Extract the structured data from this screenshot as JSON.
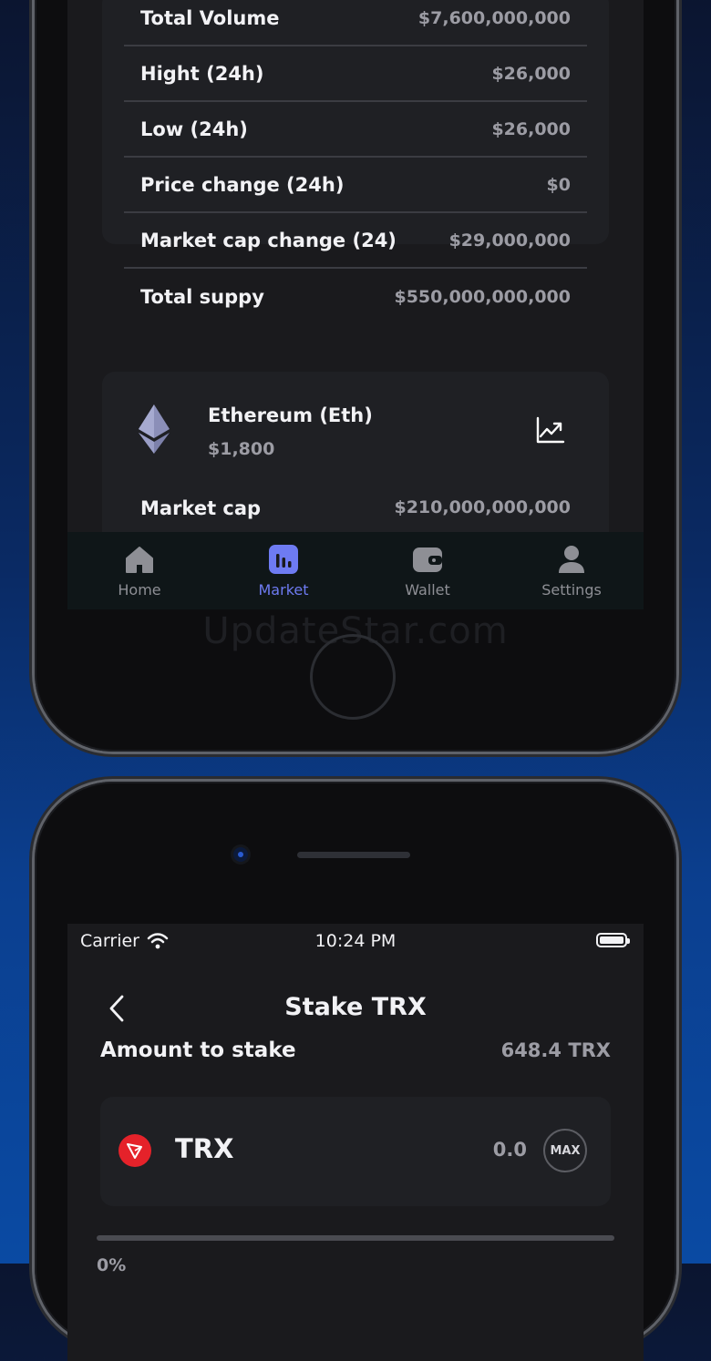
{
  "market": {
    "stats": [
      {
        "label": "Total Volume",
        "value": "$7,600,000,000"
      },
      {
        "label": "Hight (24h)",
        "value": "$26,000"
      },
      {
        "label": "Low (24h)",
        "value": "$26,000"
      },
      {
        "label": "Price change (24h)",
        "value": "$0"
      },
      {
        "label": "Market cap change (24)",
        "value": "$29,000,000"
      },
      {
        "label": "Total suppy",
        "value": "$550,000,000,000"
      }
    ],
    "coin": {
      "name": "Ethereum (Eth)",
      "price": "$1,800",
      "market_cap_label": "Market cap",
      "market_cap_value": "$210,000,000,000",
      "icon": "ethereum-icon",
      "chart_icon": "trending-chart-icon"
    },
    "tabs": [
      {
        "label": "Home",
        "icon": "home-icon",
        "active": false
      },
      {
        "label": "Market",
        "icon": "market-chart-icon",
        "active": true
      },
      {
        "label": "Wallet",
        "icon": "wallet-icon",
        "active": false
      },
      {
        "label": "Settings",
        "icon": "user-icon",
        "active": false
      }
    ],
    "active_color": "#6e7bf2"
  },
  "watermark": "UpdateStar.com",
  "stake": {
    "status": {
      "carrier": "Carrier",
      "time": "10:24 PM"
    },
    "title": "Stake TRX",
    "amount_label": "Amount to stake",
    "balance": "648.4 TRX",
    "token": {
      "name": "TRX",
      "amount": "0.0",
      "max_label": "MAX",
      "color": "#e5222a"
    },
    "slider": {
      "value_percent": 0,
      "label": "0%"
    }
  }
}
